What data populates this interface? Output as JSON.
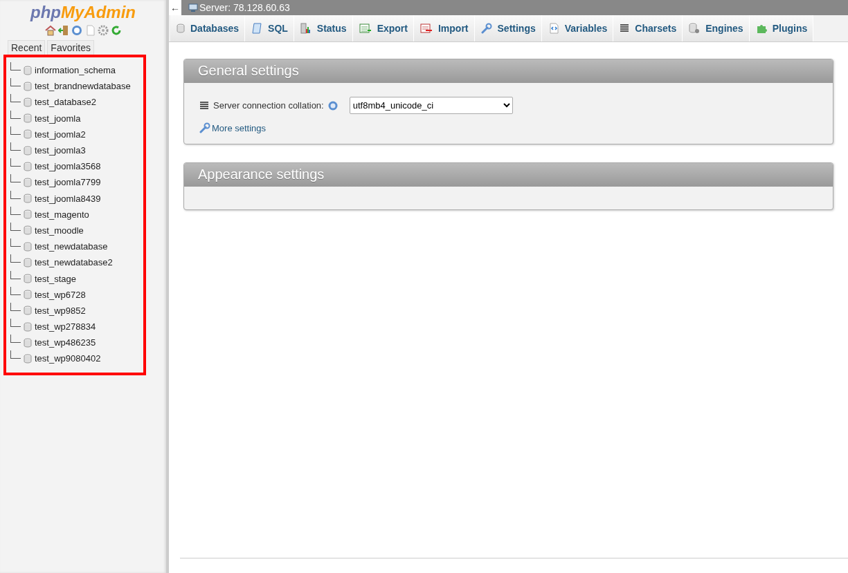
{
  "logo": {
    "part_1": "php",
    "part_2": "MyAdmin"
  },
  "nav_tabs": [
    {
      "label": "Recent"
    },
    {
      "label": "Favorites"
    }
  ],
  "databases": [
    "information_schema",
    "test_brandnewdatabase",
    "test_database2",
    "test_joomla",
    "test_joomla2",
    "test_joomla3",
    "test_joomla3568",
    "test_joomla7799",
    "test_joomla8439",
    "test_magento",
    "test_moodle",
    "test_newdatabase",
    "test_newdatabase2",
    "test_stage",
    "test_wp6728",
    "test_wp9852",
    "test_wp278834",
    "test_wp486235",
    "test_wp9080402"
  ],
  "collapse_button": "←",
  "breadcrumb": "Server: 78.128.60.63",
  "tabs": [
    {
      "label": "Databases",
      "kind": "database"
    },
    {
      "label": "SQL",
      "kind": "sql"
    },
    {
      "label": "Status",
      "kind": "status"
    },
    {
      "label": "Export",
      "kind": "export"
    },
    {
      "label": "Import",
      "kind": "import"
    },
    {
      "label": "Settings",
      "kind": "settings"
    },
    {
      "label": "Variables",
      "kind": "variables"
    },
    {
      "label": "Charsets",
      "kind": "charsets"
    },
    {
      "label": "Engines",
      "kind": "engines"
    },
    {
      "label": "Plugins",
      "kind": "plugins"
    }
  ],
  "panels": [
    {
      "title": "General settings",
      "collation_label": "Server connection collation:",
      "collation_value": "utf8mb4_unicode_ci",
      "link": "More settings"
    },
    {
      "title": "Appearance settings"
    }
  ]
}
